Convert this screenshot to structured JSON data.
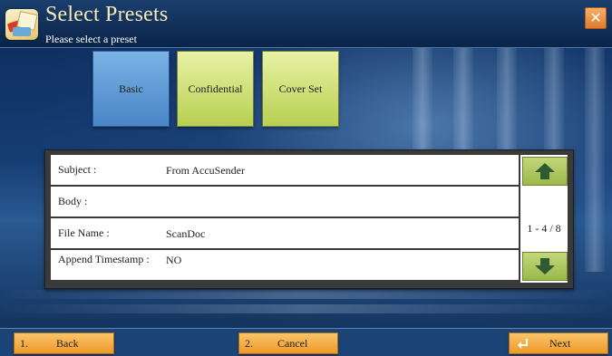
{
  "header": {
    "title": "Select Presets",
    "subtitle": "Please select a preset",
    "close_glyph": "✕"
  },
  "presets": [
    {
      "label": "Basic",
      "selected": true
    },
    {
      "label": "Confidential",
      "selected": false
    },
    {
      "label": "Cover Set",
      "selected": false
    }
  ],
  "fields": [
    {
      "label": "Subject :",
      "value": "From AccuSender"
    },
    {
      "label": "Body :",
      "value": ""
    },
    {
      "label": "File Name :",
      "value": "ScanDoc"
    },
    {
      "label": "Append Timestamp :",
      "value": "NO"
    }
  ],
  "pager": {
    "indicator": "1 - 4 / 8",
    "up_icon": "up-arrow-icon",
    "down_icon": "down-arrow-icon"
  },
  "footer": {
    "back": {
      "number": "1.",
      "label": "Back"
    },
    "cancel": {
      "number": "2.",
      "label": "Cancel"
    },
    "next": {
      "label": "Next",
      "icon": "enter-icon"
    }
  },
  "colors": {
    "preset_selected": "#4a86c8",
    "preset_default": "#b8cf52",
    "footer_button": "#ef9a2a",
    "title_text": "#f6e9b6"
  }
}
